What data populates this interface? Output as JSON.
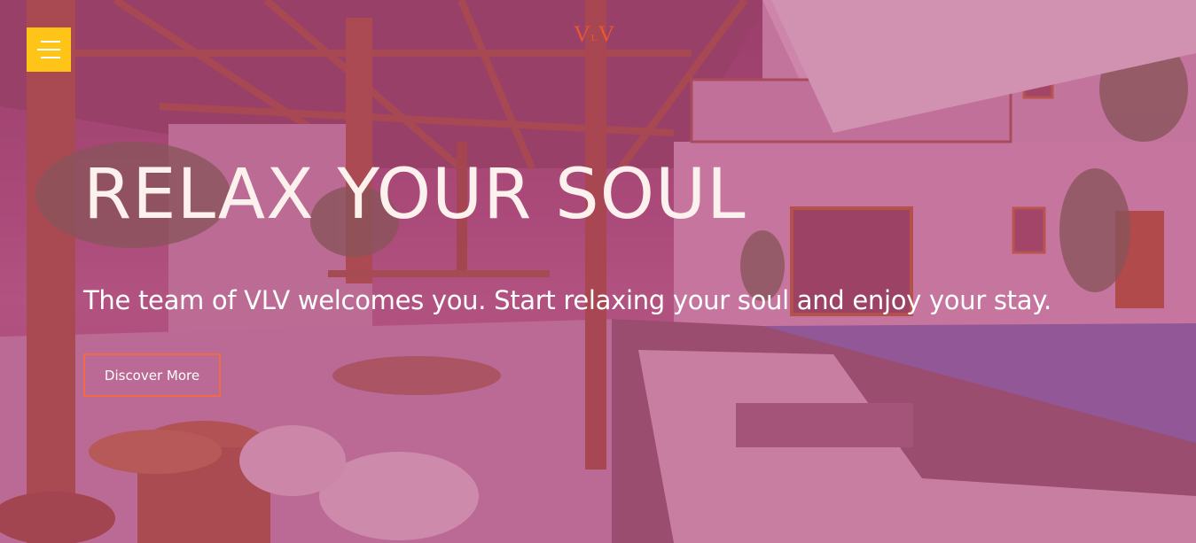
{
  "nav": {
    "menu_icon": "hamburger-menu-icon",
    "logo": {
      "left": "V",
      "middle": "L",
      "right": "V"
    }
  },
  "hero": {
    "title": "RELAX YOUR SOUL",
    "subtitle": "The team of VLV welcomes you. Start relaxing your soul and enjoy your stay.",
    "cta_label": "Discover More"
  },
  "colors": {
    "menu_button": "#ffc418",
    "accent": "#f06a44",
    "logo": "#e8572e",
    "overlay": "#af3773"
  }
}
